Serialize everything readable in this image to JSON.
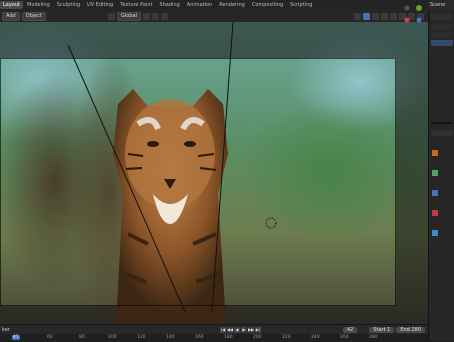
{
  "workspace_tabs": [
    "Layout",
    "Modeling",
    "Sculpting",
    "UV Editing",
    "Texture Paint",
    "Shading",
    "Animation",
    "Rendering",
    "Compositing",
    "Scripting"
  ],
  "active_tab": "Layout",
  "scene_label": "Scene",
  "viewport_header": {
    "add_label": "Add",
    "object_label": "Object",
    "orientation_label": "Global"
  },
  "timeline": {
    "left_label": "ker",
    "current_frame": "42",
    "start_label": "Start",
    "start_value": "1",
    "end_label": "End",
    "end_value": "280",
    "ruler_ticks": [
      "41",
      "60",
      "80",
      "100",
      "120",
      "140",
      "160",
      "180",
      "200",
      "220",
      "240",
      "260",
      "280"
    ]
  },
  "colors": {
    "accent": "#4772b3",
    "active_tab": "#4a4a4a",
    "header": "#242424"
  }
}
